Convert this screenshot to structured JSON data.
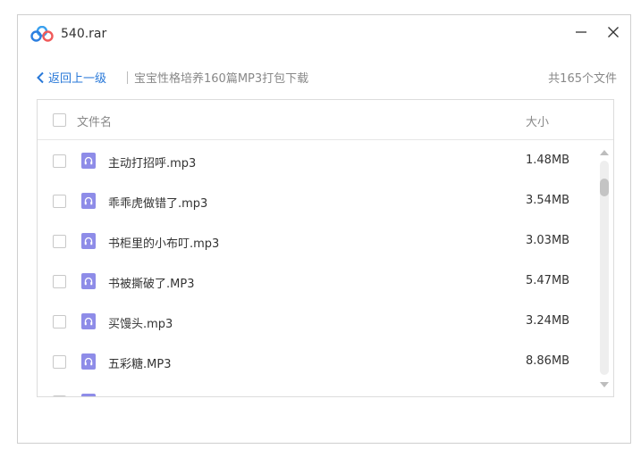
{
  "window": {
    "title": "540.rar",
    "icon": "baidu-netdisk-cloud-icon"
  },
  "breadcrumb": {
    "back_label": "返回上一级",
    "path": "宝宝性格培养160篇MP3打包下载",
    "count": "共165个文件"
  },
  "list": {
    "header_name": "文件名",
    "header_size": "大小",
    "rows": [
      {
        "name": "主动打招呼.mp3",
        "size": "1.48MB"
      },
      {
        "name": "乖乖虎做错了.mp3",
        "size": "3.54MB"
      },
      {
        "name": "书柜里的小布叮.mp3",
        "size": "3.03MB"
      },
      {
        "name": "书被撕破了.MP3",
        "size": "5.47MB"
      },
      {
        "name": "买馒头.mp3",
        "size": "3.24MB"
      },
      {
        "name": "五彩糖.MP3",
        "size": "8.86MB"
      },
      {
        "name": "",
        "size": ""
      }
    ]
  },
  "colors": {
    "accent": "#2878d8",
    "audio_icon": "#8e8ce8"
  }
}
